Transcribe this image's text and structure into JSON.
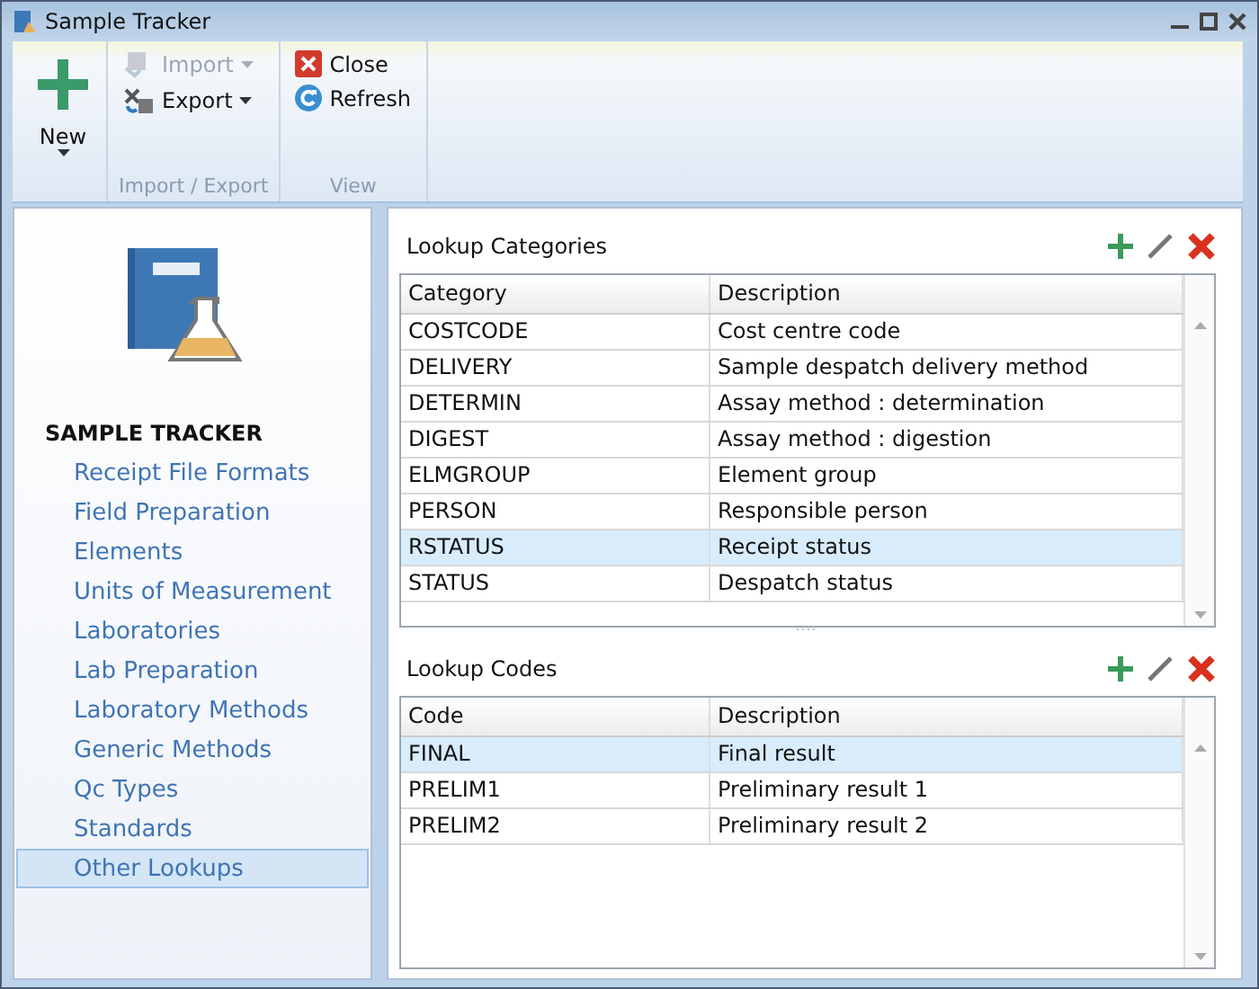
{
  "window": {
    "title": "Sample Tracker"
  },
  "ribbon": {
    "new_button": {
      "label": "New"
    },
    "groups": [
      {
        "label": "Import / Export",
        "buttons": [
          {
            "label": "Import",
            "kind": "import",
            "disabled": true,
            "dropdown": true
          },
          {
            "label": "Export",
            "kind": "export",
            "disabled": false,
            "dropdown": true
          }
        ]
      },
      {
        "label": "View",
        "buttons": [
          {
            "label": "Close",
            "kind": "close",
            "disabled": false,
            "dropdown": false
          },
          {
            "label": "Refresh",
            "kind": "refresh",
            "disabled": false,
            "dropdown": false
          }
        ]
      }
    ]
  },
  "sidebar": {
    "heading": "SAMPLE TRACKER",
    "items": [
      {
        "label": "Receipt File Formats",
        "selected": false
      },
      {
        "label": "Field Preparation",
        "selected": false
      },
      {
        "label": "Elements",
        "selected": false
      },
      {
        "label": "Units of Measurement",
        "selected": false
      },
      {
        "label": "Laboratories",
        "selected": false
      },
      {
        "label": "Lab Preparation",
        "selected": false
      },
      {
        "label": "Laboratory Methods",
        "selected": false
      },
      {
        "label": "Generic Methods",
        "selected": false
      },
      {
        "label": "Qc Types",
        "selected": false
      },
      {
        "label": "Standards",
        "selected": false
      },
      {
        "label": "Other Lookups",
        "selected": true
      }
    ]
  },
  "panels": [
    {
      "title": "Lookup Categories",
      "columns": [
        "Category",
        "Description"
      ],
      "rows": [
        {
          "cells": [
            "COSTCODE",
            "Cost centre code"
          ],
          "selected": false
        },
        {
          "cells": [
            "DELIVERY",
            "Sample despatch delivery method"
          ],
          "selected": false
        },
        {
          "cells": [
            "DETERMIN",
            "Assay method : determination"
          ],
          "selected": false
        },
        {
          "cells": [
            "DIGEST",
            "Assay method : digestion"
          ],
          "selected": false
        },
        {
          "cells": [
            "ELMGROUP",
            "Element group"
          ],
          "selected": false
        },
        {
          "cells": [
            "PERSON",
            "Responsible person"
          ],
          "selected": false
        },
        {
          "cells": [
            "RSTATUS",
            "Receipt status"
          ],
          "selected": true
        },
        {
          "cells": [
            "STATUS",
            "Despatch status"
          ],
          "selected": false
        }
      ]
    },
    {
      "title": "Lookup Codes",
      "columns": [
        "Code",
        "Description"
      ],
      "rows": [
        {
          "cells": [
            "FINAL",
            "Final result"
          ],
          "selected": true
        },
        {
          "cells": [
            "PRELIM1",
            "Preliminary result 1"
          ],
          "selected": false
        },
        {
          "cells": [
            "PRELIM2",
            "Preliminary result 2"
          ],
          "selected": false
        }
      ]
    }
  ]
}
